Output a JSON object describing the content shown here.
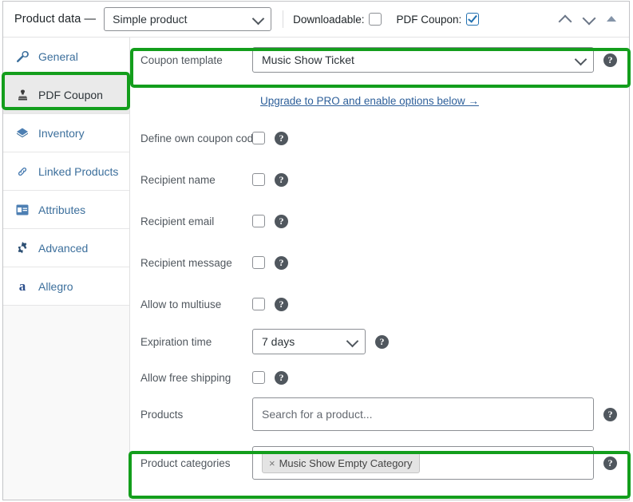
{
  "header": {
    "title": "Product data —",
    "product_type": "Simple product",
    "downloadable_label": "Downloadable:",
    "downloadable_checked": false,
    "pdf_coupon_label": "PDF Coupon:",
    "pdf_coupon_checked": true,
    "tools": {
      "move_up": "move-up",
      "move_down": "move-down",
      "toggle": "toggle-panel"
    }
  },
  "sidebar": {
    "items": [
      {
        "label": "General",
        "icon": "wrench-icon",
        "active": false
      },
      {
        "label": "PDF Coupon",
        "icon": "stamp-icon",
        "active": true
      },
      {
        "label": "Inventory",
        "icon": "box-icon",
        "active": false
      },
      {
        "label": "Linked Products",
        "icon": "link-icon",
        "active": false
      },
      {
        "label": "Attributes",
        "icon": "window-icon",
        "active": false
      },
      {
        "label": "Advanced",
        "icon": "gear-icon",
        "active": false
      },
      {
        "label": "Allegro",
        "icon": "allegro-icon",
        "active": false
      }
    ]
  },
  "form": {
    "coupon_template": {
      "label": "Coupon template",
      "value": "Music Show Ticket"
    },
    "upgrade_link": "Upgrade to PRO and enable options below →",
    "define_own_coupon_code": {
      "label": "Define own coupon code",
      "checked": false
    },
    "recipient_name": {
      "label": "Recipient name",
      "checked": false
    },
    "recipient_email": {
      "label": "Recipient email",
      "checked": false
    },
    "recipient_message": {
      "label": "Recipient message",
      "checked": false
    },
    "allow_multiuse": {
      "label": "Allow to multiuse",
      "checked": false
    },
    "expiration_time": {
      "label": "Expiration time",
      "value": "7 days"
    },
    "allow_free_shipping": {
      "label": "Allow free shipping",
      "checked": false
    },
    "products": {
      "label": "Products",
      "placeholder": "Search for a product..."
    },
    "product_categories": {
      "label": "Product categories",
      "tags": [
        {
          "remove": "×",
          "text": "Music Show Empty Category"
        }
      ]
    },
    "help_glyph": "?"
  },
  "highlights": {
    "accent_color": "#139e1c",
    "regions": [
      "pdf-coupon-tab",
      "coupon-template-row",
      "product-categories-row"
    ]
  }
}
